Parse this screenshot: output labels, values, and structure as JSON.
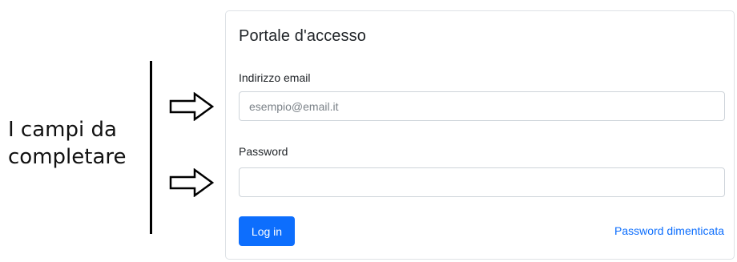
{
  "annotation": {
    "line1": "I campi da",
    "line2": "completare"
  },
  "login": {
    "title": "Portale d'accesso",
    "email_label": "Indirizzo email",
    "email_placeholder": "esempio@email.it",
    "email_value": "",
    "password_label": "Password",
    "password_placeholder": "",
    "password_value": "",
    "submit_label": "Log in",
    "forgot_label": "Password dimenticata"
  },
  "colors": {
    "primary": "#0d6efd",
    "border": "#dee2e6",
    "input_border": "#ced4da",
    "arrow": "#000000"
  },
  "icons": {
    "arrow_1": "right-arrow-outline-icon",
    "arrow_2": "right-arrow-outline-icon"
  }
}
